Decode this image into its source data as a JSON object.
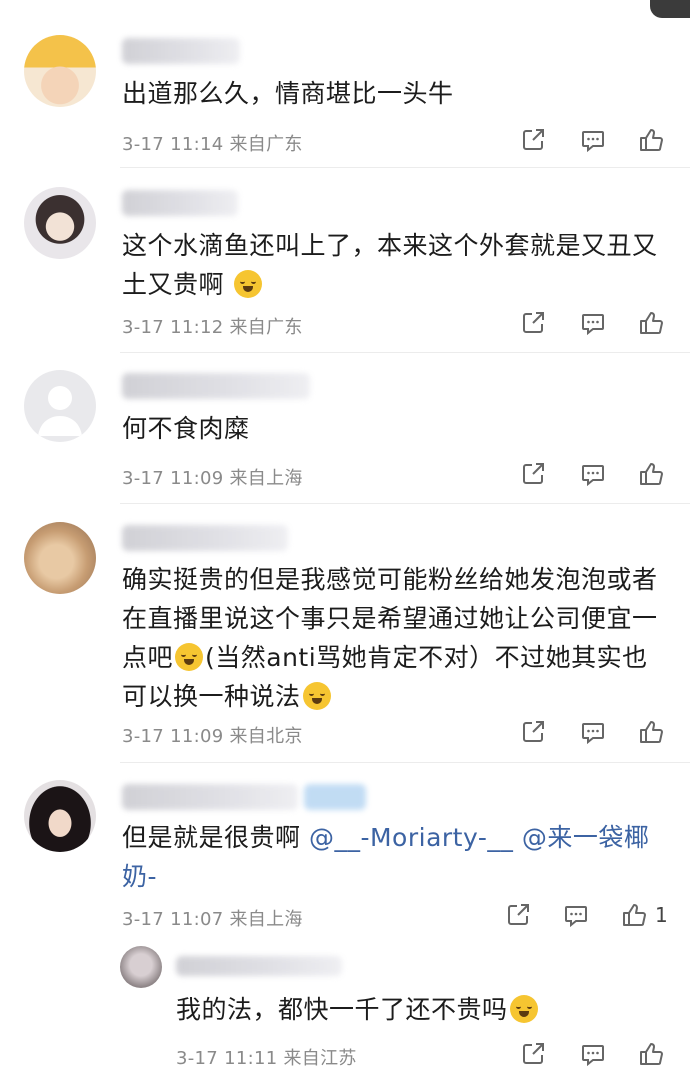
{
  "comments": [
    {
      "text": "出道那么久，情商堪比一头牛",
      "time": "3-17 11:14",
      "location": "来自广东"
    },
    {
      "text_line1": "这个水滴鱼还叫上了，本来这个外套就是又丑又",
      "text_line2": "土又贵啊",
      "time": "3-17 11:12",
      "location": "来自广东"
    },
    {
      "text": "何不食肉糜",
      "time": "3-17 11:09",
      "location": "来自上海"
    },
    {
      "text_line1": "确实挺贵的但是我感觉可能粉丝给她发泡泡或者",
      "text_line2": "在直播里说这个事只是希望通过她让公司便宜一",
      "text_line3a": "点吧",
      "text_line3b": "(当然anti骂她肯定不对）不过她其实也",
      "text_line4": "可以换一种说法",
      "time": "3-17 11:09",
      "location": "来自北京"
    },
    {
      "text_prefix": "但是就是很贵啊",
      "mention1": "@__-Moriarty-__",
      "mention2": "@来一袋椰",
      "text_line2": "奶-",
      "time": "3-17 11:07",
      "location": "来自上海",
      "likes": "1"
    }
  ],
  "reply": {
    "text": "我的法，都快一千了还不贵吗",
    "time": "3-17 11:11",
    "location": "来自江苏"
  },
  "icons": [
    "share-icon",
    "comment-icon",
    "like-icon"
  ],
  "colors": {
    "meta": "#8a8a8a",
    "mention": "#3c63a3",
    "divider": "#ececec"
  }
}
